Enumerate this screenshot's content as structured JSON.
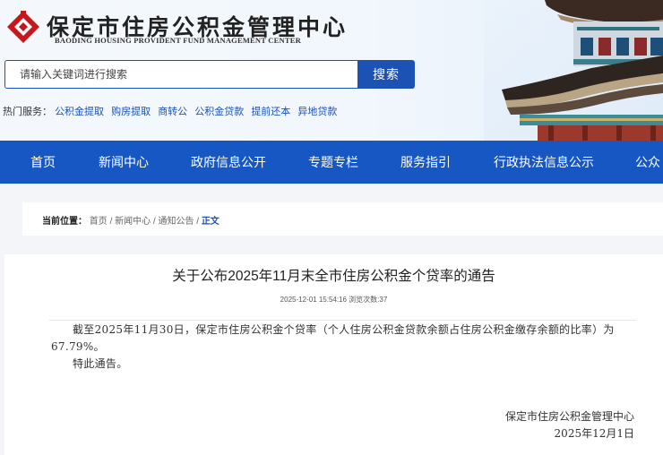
{
  "site": {
    "title_cn": "保定市住房公积金管理中心",
    "title_en": "BAODING HOUSING PROVIDENT FUND MANAGEMENT CENTER"
  },
  "search": {
    "placeholder": "请输入关键词进行搜索",
    "button_label": "搜索"
  },
  "hot_services": {
    "label": "热门服务：",
    "links": [
      "公积金提取",
      "购房提取",
      "商转公",
      "公积金贷款",
      "提前还本",
      "异地贷款"
    ]
  },
  "nav": {
    "items": [
      "首页",
      "新闻中心",
      "政府信息公开",
      "专题专栏",
      "服务指引",
      "行政执法信息公示",
      "公众"
    ]
  },
  "breadcrumb": {
    "label": "当前位置：",
    "items": [
      "首页",
      "新闻中心",
      "通知公告"
    ],
    "separator": "/",
    "current": "正文"
  },
  "article": {
    "title": "关于公布2025年11月末全市住房公积金个贷率的通告",
    "meta": "2025-12-01 15:54:16 浏览次数:37",
    "paragraphs": [
      "截至2025年11月30日，保定市住房公积金个贷率（个人住房公积金贷款余额占住房公积金缴存余额的比率）为67.79%。",
      "特此通告。"
    ],
    "signature": "保定市住房公积金管理中心",
    "date": "2025年12月1日"
  },
  "colors": {
    "brand": "#1b52b3",
    "nav_bg": "#1657c4",
    "logo_red": "#c8161d"
  }
}
